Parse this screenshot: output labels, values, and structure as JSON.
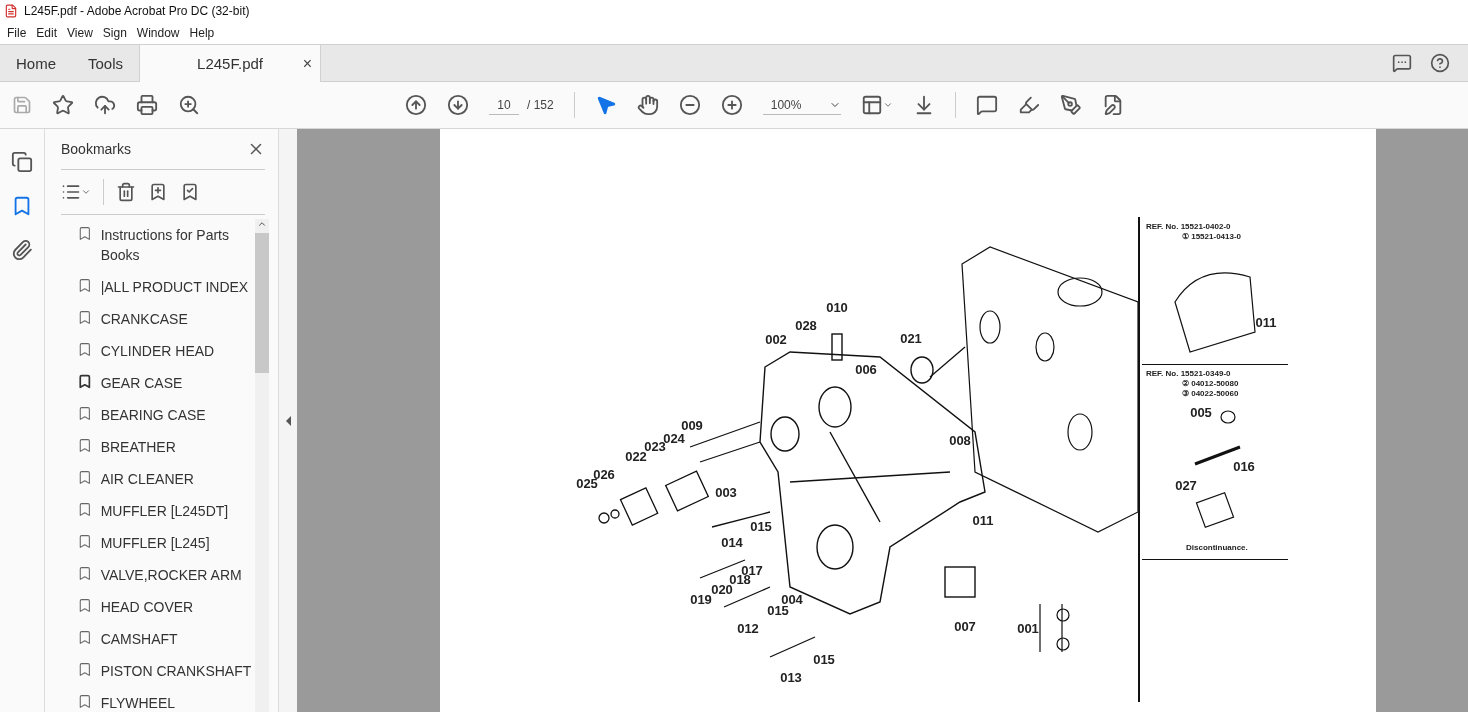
{
  "window": {
    "title": "L245F.pdf - Adobe Acrobat Pro DC (32-bit)"
  },
  "menu": [
    "File",
    "Edit",
    "View",
    "Sign",
    "Window",
    "Help"
  ],
  "tabs": [
    {
      "label": "Home",
      "selected": false
    },
    {
      "label": "Tools",
      "selected": false
    },
    {
      "label": "L245F.pdf",
      "selected": true,
      "close": "×"
    }
  ],
  "toolbar": {
    "page_number": "10",
    "page_total": "/ 152",
    "zoom": "100%"
  },
  "rail": [
    {
      "kind": "pages",
      "selected": false
    },
    {
      "kind": "bookmarks",
      "selected": true
    },
    {
      "kind": "attachments",
      "selected": false
    }
  ],
  "sidebar": {
    "title": "Bookmarks",
    "bookmarks": [
      {
        "label": "Instructions for Parts Books",
        "current": false
      },
      {
        "label": "|ALL PRODUCT INDEX",
        "current": false
      },
      {
        "label": "CRANKCASE",
        "current": false
      },
      {
        "label": "CYLINDER HEAD",
        "current": false
      },
      {
        "label": "GEAR CASE",
        "current": true
      },
      {
        "label": "BEARING CASE",
        "current": false
      },
      {
        "label": "BREATHER",
        "current": false
      },
      {
        "label": "AIR CLEANER",
        "current": false
      },
      {
        "label": "MUFFLER [L245DT]",
        "current": false
      },
      {
        "label": "MUFFLER [L245]",
        "current": false
      },
      {
        "label": "VALVE,ROCKER ARM",
        "current": false
      },
      {
        "label": "HEAD COVER",
        "current": false
      },
      {
        "label": "CAMSHAFT",
        "current": false
      },
      {
        "label": "PISTON CRANKSHAFT",
        "current": false
      },
      {
        "label": "FLYWHEEL",
        "current": false
      }
    ]
  },
  "document": {
    "part_labels": [
      "010",
      "028",
      "002",
      "021",
      "006",
      "009",
      "024",
      "023",
      "022",
      "026",
      "025",
      "008",
      "003",
      "015",
      "014",
      "011",
      "017",
      "018",
      "020",
      "019",
      "004",
      "015",
      "012",
      "007",
      "001",
      "015",
      "013"
    ],
    "inset_top": {
      "lines": [
        "REF. No. 15521-0402-0",
        "① 15521-0413-0"
      ],
      "labels": [
        "011"
      ]
    },
    "inset_bottom": {
      "lines": [
        "REF. No. 15521-0349-0",
        "② 04012-50080",
        "③ 04022-50060"
      ],
      "labels": [
        "005",
        "016",
        "027"
      ],
      "note": "Discontinuance."
    }
  }
}
